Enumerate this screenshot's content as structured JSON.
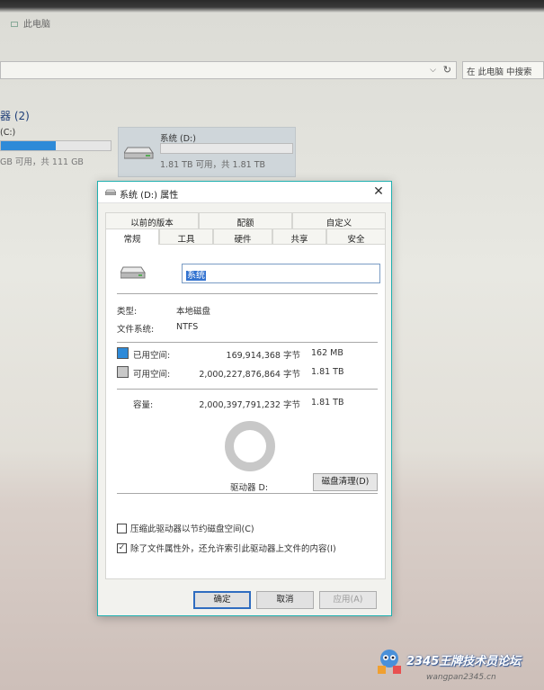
{
  "explorer": {
    "window_title": "此电脑",
    "search_placeholder": "在 此电脑 中搜索",
    "group_title": "器 (2)",
    "drive_c": {
      "label": "(C:)",
      "info": "GB 可用，共 111 GB",
      "used_fraction": 0.5
    },
    "drive_d": {
      "label": "系统 (D:)",
      "info": "1.81 TB 可用，共 1.81 TB",
      "used_fraction": 0.0
    }
  },
  "dialog": {
    "title": "系统 (D:) 属性",
    "tabs_top": [
      "以前的版本",
      "配额",
      "自定义"
    ],
    "tabs_bottom": [
      "常规",
      "工具",
      "硬件",
      "共享",
      "安全"
    ],
    "active_tab": "常规",
    "volume_name": "系统",
    "type_label": "类型:",
    "type_value": "本地磁盘",
    "fs_label": "文件系统:",
    "fs_value": "NTFS",
    "used_label": "已用空间:",
    "used_bytes": "169,914,368 字节",
    "used_human": "162 MB",
    "free_label": "可用空间:",
    "free_bytes": "2,000,227,876,864 字节",
    "free_human": "1.81 TB",
    "capacity_label": "容量:",
    "capacity_bytes": "2,000,397,791,232 字节",
    "capacity_human": "1.81 TB",
    "drive_letter": "驱动器 D:",
    "cleanup_button": "磁盘清理(D)",
    "compress_label": "压缩此驱动器以节约磁盘空间(C)",
    "compress_checked": false,
    "index_label": "除了文件属性外，还允许索引此驱动器上文件的内容(I)",
    "index_checked": true,
    "ok_button": "确定",
    "cancel_button": "取消",
    "apply_button": "应用(A)",
    "colors": {
      "used": "#2e8ad8",
      "free": "#c8c8c8",
      "titlebar_accent": "#1fb0b0"
    }
  },
  "watermark": {
    "brand": "2345王牌技术员论坛",
    "url": "wangpan2345.cn"
  }
}
